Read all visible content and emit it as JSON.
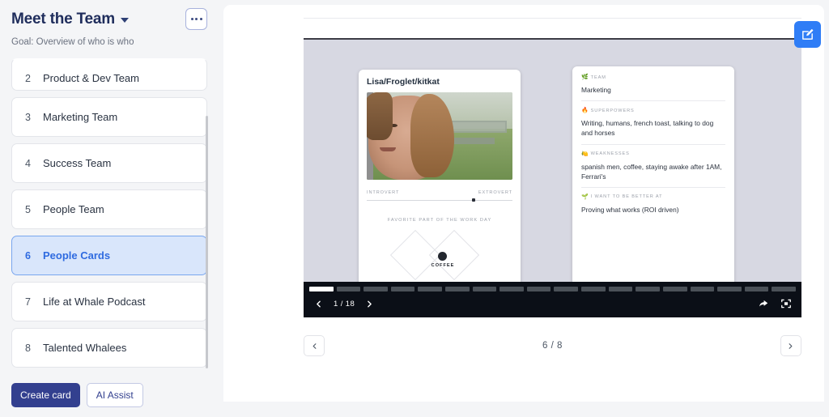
{
  "sidebar": {
    "title": "Meet the Team",
    "menu_icon": "ellipsis-icon",
    "caret_icon": "chevron-down-icon",
    "goal": "Goal: Overview of who is who",
    "items": [
      {
        "num": "2",
        "label": "Product & Dev Team",
        "active": false
      },
      {
        "num": "3",
        "label": "Marketing Team",
        "active": false
      },
      {
        "num": "4",
        "label": "Success Team",
        "active": false
      },
      {
        "num": "5",
        "label": "People Team",
        "active": false
      },
      {
        "num": "6",
        "label": "People Cards",
        "active": true
      },
      {
        "num": "7",
        "label": "Life at Whale Podcast",
        "active": false
      },
      {
        "num": "8",
        "label": "Talented Whalees",
        "active": false
      }
    ],
    "create_button": "Create card",
    "ai_button": "AI Assist"
  },
  "main": {
    "edit_button_icon": "edit-square-icon",
    "profile_card": {
      "name": "Lisa/Froglet/kitkat",
      "photo_alt": "portrait-photo",
      "slider": {
        "left_label": "INTROVERT",
        "right_label": "EXTROVERT",
        "value_percent": 72
      },
      "favorite_label": "FAVORITE PART OF THE WORK DAY",
      "favorite_value": "COFFEE"
    },
    "info_card": {
      "sections": [
        {
          "emoji": "🌿",
          "icon": "plant-icon",
          "label": "TEAM",
          "value": "Marketing"
        },
        {
          "emoji": "🔥",
          "icon": "fire-icon",
          "label": "SUPERPOWERS",
          "value": "Writing, humans, french toast, talking to dog and horses"
        },
        {
          "emoji": "🍋",
          "icon": "lemon-icon",
          "label": "WEAKNESSES",
          "value": "spanish men, coffee, staying awake after 1AM, Ferrari's"
        },
        {
          "emoji": "🌱",
          "icon": "seedling-icon",
          "label": "I WANT TO BE BETTER AT",
          "value": "Proving what works (ROI driven)"
        }
      ]
    },
    "player": {
      "prev_icon": "chevron-left-icon",
      "next_icon": "chevron-right-icon",
      "counter": "1 / 18",
      "total_segments": 18,
      "active_segment": 1,
      "share_icon": "share-arrow-icon",
      "fullscreen_icon": "fullscreen-icon"
    },
    "pager": {
      "prev_icon": "chevron-left-icon",
      "next_icon": "chevron-right-icon",
      "counter": "6 / 8"
    }
  },
  "colors": {
    "accent_blue": "#2f7df6",
    "title_navy": "#1f2d5c",
    "primary_button": "#33408f",
    "active_item_bg": "#d9e6fb",
    "embed_bg": "#d7d8e2",
    "player_bg": "#0b0f17"
  }
}
